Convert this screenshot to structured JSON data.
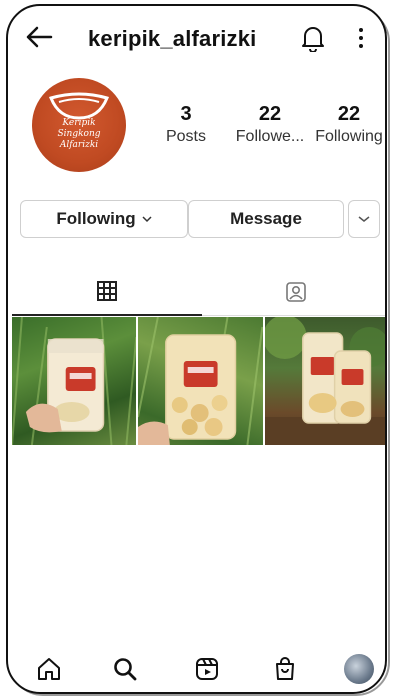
{
  "header": {
    "username": "keripik_alfarizki",
    "icons": {
      "back": "arrow-left-icon",
      "notifications": "bell-icon",
      "more": "vertical-dots-icon"
    }
  },
  "profile": {
    "avatar_text": [
      "Keripik",
      "Singkong",
      "Alfarizki"
    ],
    "avatar_color": "#c04a22",
    "stats": [
      {
        "value": "3",
        "label": "Posts"
      },
      {
        "value": "22",
        "label": "Followe..."
      },
      {
        "value": "22",
        "label": "Following"
      }
    ]
  },
  "actions": {
    "following_label": "Following",
    "message_label": "Message"
  },
  "tabs": [
    {
      "icon": "grid-icon",
      "active": true
    },
    {
      "icon": "tagged-person-icon",
      "active": false
    }
  ],
  "posts": [
    {
      "thumbnail": "cassava-chips-bag-photo-1"
    },
    {
      "thumbnail": "cassava-chips-bag-photo-2"
    },
    {
      "thumbnail": "cassava-chips-bags-photo-3"
    }
  ],
  "bottom_nav": [
    {
      "icon": "home-icon"
    },
    {
      "icon": "search-icon"
    },
    {
      "icon": "reels-icon"
    },
    {
      "icon": "shop-icon"
    },
    {
      "icon": "profile-avatar"
    }
  ]
}
